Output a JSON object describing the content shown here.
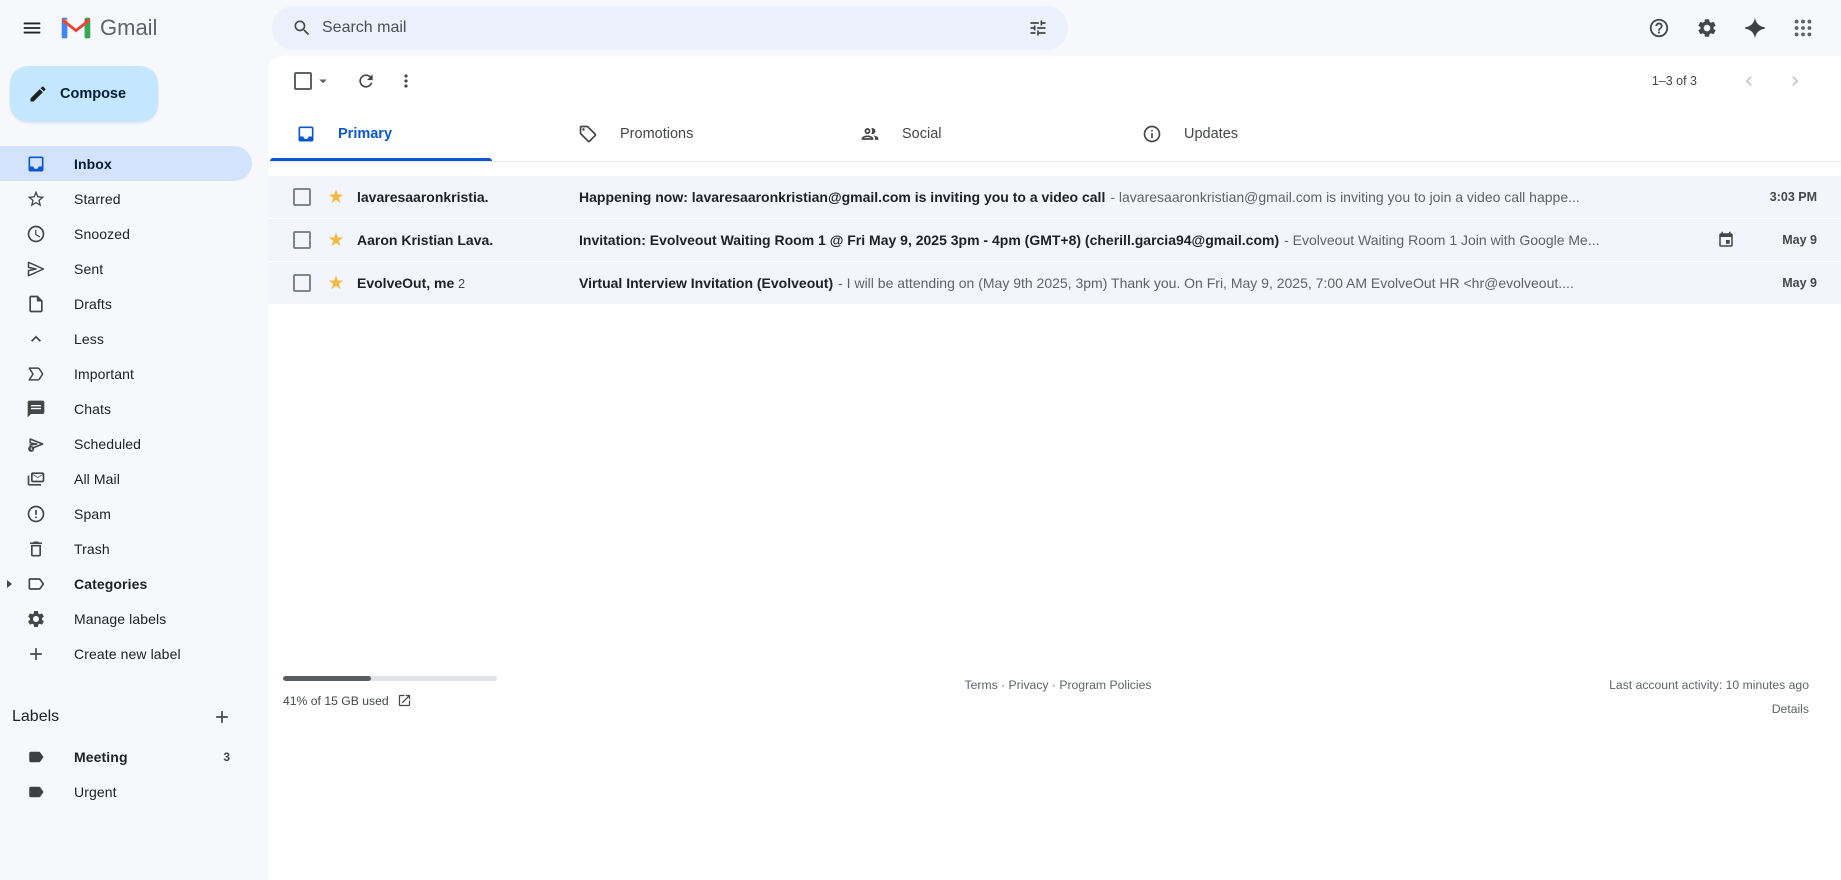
{
  "header": {
    "product_name": "Gmail",
    "search_placeholder": "Search mail"
  },
  "sidebar": {
    "compose_label": "Compose",
    "items": [
      {
        "label": "Inbox"
      },
      {
        "label": "Starred"
      },
      {
        "label": "Snoozed"
      },
      {
        "label": "Sent"
      },
      {
        "label": "Drafts"
      },
      {
        "label": "Less"
      },
      {
        "label": "Important"
      },
      {
        "label": "Chats"
      },
      {
        "label": "Scheduled"
      },
      {
        "label": "All Mail"
      },
      {
        "label": "Spam"
      },
      {
        "label": "Trash"
      },
      {
        "label": "Categories"
      },
      {
        "label": "Manage labels"
      },
      {
        "label": "Create new label"
      }
    ],
    "labels_section": {
      "title": "Labels",
      "labels": [
        {
          "name": "Meeting",
          "count": "3"
        },
        {
          "name": "Urgent",
          "count": ""
        }
      ]
    }
  },
  "toolbar": {
    "pagination": "1–3 of 3"
  },
  "tabs": [
    {
      "label": "Primary"
    },
    {
      "label": "Promotions"
    },
    {
      "label": "Social"
    },
    {
      "label": "Updates"
    }
  ],
  "emails": [
    {
      "sender": "lavaresaaronkristia.",
      "thread_count": "",
      "subject": "Happening now: lavaresaaronkristian@gmail.com is inviting you to a video call",
      "snippet": "- lavaresaaronkristian@gmail.com is inviting you to join a video call happe...",
      "date": "3:03 PM",
      "starred": true
    },
    {
      "sender": "Aaron Kristian Lava.",
      "thread_count": "",
      "subject": "Invitation: Evolveout Waiting Room 1 @ Fri May 9, 2025 3pm - 4pm (GMT+8) (cherill.garcia94@gmail.com)",
      "snippet": "- Evolveout Waiting Room 1 Join with Google Me...",
      "date": "May 9",
      "starred": true
    },
    {
      "sender": "EvolveOut, me",
      "thread_count": "2",
      "subject": "Virtual Interview Invitation (Evolveout)",
      "snippet": "- I will be attending on (May 9th 2025, 3pm) Thank you. On Fri, May 9, 2025, 7:00 AM EvolveOut HR <hr@evolveout....",
      "date": "May 9",
      "starred": true
    }
  ],
  "footer": {
    "storage_percent": 41,
    "storage_text": "41% of 15 GB used",
    "links_text": "Terms · Privacy · Program Policies",
    "activity": "Last account activity: 10 minutes ago",
    "details_label": "Details"
  },
  "colors": {
    "accent_blue": "#0b57d0",
    "compose_bg": "#c2e7ff",
    "active_item_bg": "#d3e3fd",
    "row_bg": "#f2f6fc",
    "star_yellow": "#f5b942"
  }
}
